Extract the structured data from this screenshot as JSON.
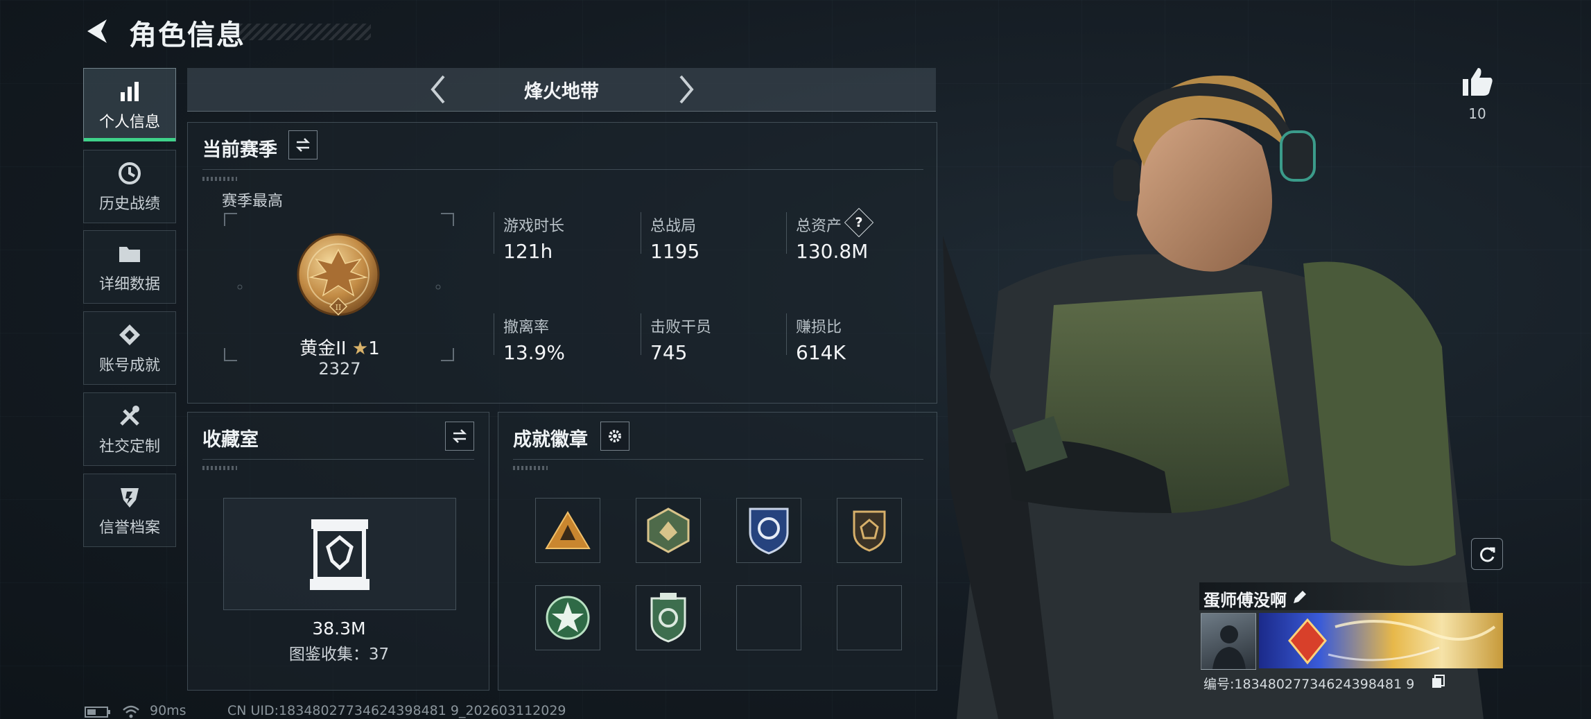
{
  "header": {
    "title": "角色信息"
  },
  "sidebar": {
    "items": [
      {
        "label": "个人信息",
        "icon": "bar-chart-icon",
        "active": true
      },
      {
        "label": "历史战绩",
        "icon": "history-clock-icon"
      },
      {
        "label": "详细数据",
        "icon": "folder-icon"
      },
      {
        "label": "账号成就",
        "icon": "achievement-icon"
      },
      {
        "label": "社交定制",
        "icon": "tools-icon"
      },
      {
        "label": "信誉档案",
        "icon": "shield-icon"
      }
    ]
  },
  "mode": {
    "name": "烽火地带"
  },
  "season": {
    "title": "当前赛季",
    "best_label": "赛季最高",
    "rank_name": "黄金II",
    "rank_stars": "1",
    "rank_points": "2327",
    "stats": [
      {
        "label": "游戏时长",
        "value": "121h"
      },
      {
        "label": "总战局",
        "value": "1195"
      },
      {
        "label": "总资产",
        "value": "130.8M",
        "help": "?"
      },
      {
        "label": "撤离率",
        "value": "13.9%"
      },
      {
        "label": "击败干员",
        "value": "745"
      },
      {
        "label": "赚损比",
        "value": "614K"
      }
    ]
  },
  "collection": {
    "title": "收藏室",
    "value": "38.3M",
    "catalog": "图鉴收集：37"
  },
  "achievements": {
    "title": "成就徽章"
  },
  "profile": {
    "likes": "10",
    "nickname": "蛋师傅没啊",
    "player_id": "编号:18348027734624398481 9"
  },
  "footer": {
    "ping": "90ms",
    "uid": "CN UID:18348027734624398481 9_202603112029"
  },
  "colors": {
    "accent": "#3fd28a",
    "gold": "#c9a35a"
  }
}
